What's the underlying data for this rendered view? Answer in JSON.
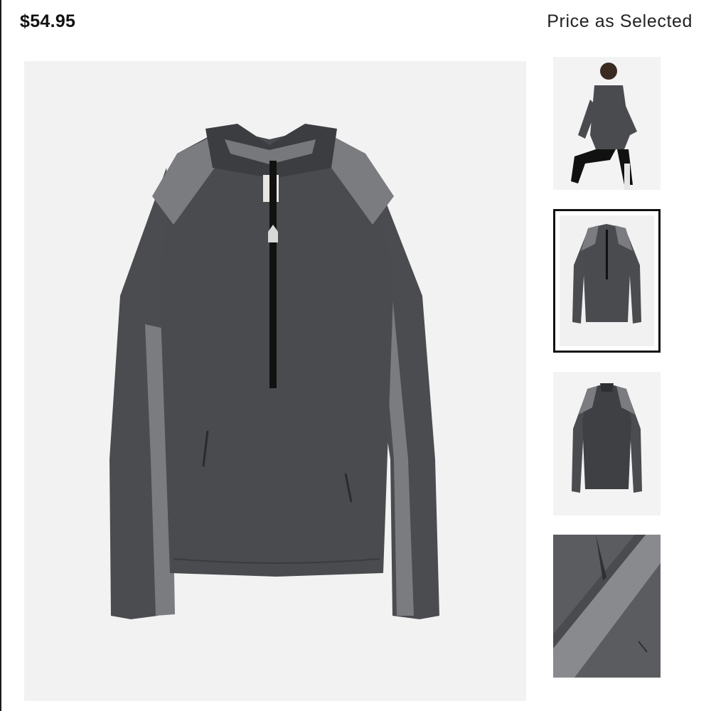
{
  "product": {
    "price": "$54.95",
    "price_note": "Price as Selected"
  },
  "gallery": {
    "main_image": "half-zip-pullover-front",
    "thumbnails": [
      {
        "name": "model-wearing-pullover",
        "selected": false
      },
      {
        "name": "pullover-front",
        "selected": true
      },
      {
        "name": "pullover-back",
        "selected": false
      },
      {
        "name": "cuff-detail",
        "selected": false
      }
    ]
  },
  "colors": {
    "body": "#4a4b4f",
    "panel": "#7a7b7e",
    "zipper": "#111111",
    "background": "#f2f2f2",
    "selected_border": "#111111"
  }
}
